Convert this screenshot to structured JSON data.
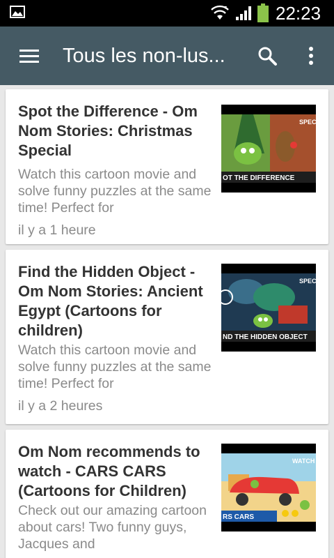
{
  "status_bar": {
    "time": "22:23",
    "icons": [
      "gallery-icon",
      "wifi-icon",
      "signal-icon",
      "battery-icon"
    ],
    "battery_color": "#8bc34a"
  },
  "app_bar": {
    "title": "Tous les non-lus...",
    "background": "#455a64",
    "icons": [
      "menu-icon",
      "search-icon",
      "more-vert-icon"
    ]
  },
  "feed": {
    "items": [
      {
        "title": "Spot the Difference - Om Nom Stories: Christmas Special",
        "description": "Watch this cartoon movie and solve funny puzzles at the same time! Perfect for",
        "time": "il y a 1 heure",
        "thumb_caption": "OT THE DIFFERENCE",
        "thumb_tag": "SPEC"
      },
      {
        "title": "Find the Hidden Object - Om Nom Stories: Ancient Egypt (Cartoons for children)",
        "description": "Watch this cartoon movie and solve funny puzzles at the same time! Perfect for",
        "time": "il y a 2 heures",
        "thumb_caption": "ND THE HIDDEN OBJECT",
        "thumb_tag": "SPEC"
      },
      {
        "title": "Om Nom recommends to watch - CARS CARS (Cartoons for Children)",
        "description": "Check out our amazing cartoon about cars! Two funny guys, Jacques and",
        "time": "",
        "thumb_caption": "RS CARS",
        "thumb_tag": "WATCH"
      }
    ]
  }
}
